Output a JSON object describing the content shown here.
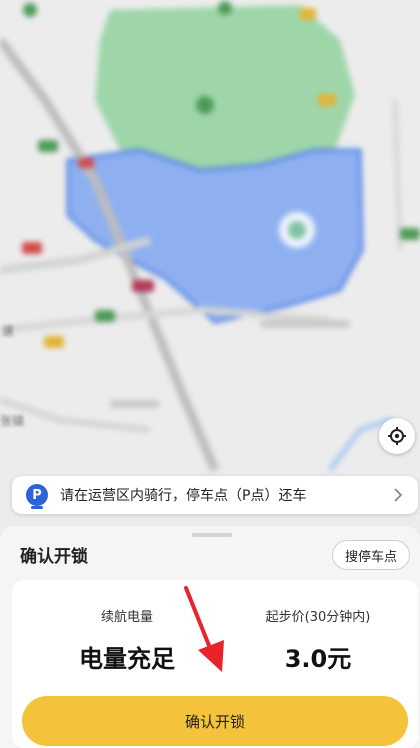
{
  "map": {
    "labels": [
      "速",
      "张镇"
    ]
  },
  "notice": {
    "icon_letter": "P",
    "text": "请在运营区内骑行，停车点（P点）还车"
  },
  "sheet": {
    "title": "确认开锁",
    "park_button": "搜停车点",
    "battery": {
      "label": "续航电量",
      "value": "电量充足"
    },
    "price": {
      "label": "起步价(30分钟内)",
      "value": "3.0元"
    },
    "confirm_button": "确认开锁"
  },
  "colors": {
    "accent_yellow": "#f5c33b",
    "parking_blue": "#2d63d9",
    "service_area": "#8fb0f0",
    "park_green": "#9ed6a9",
    "annotation_red": "#e8242a"
  }
}
